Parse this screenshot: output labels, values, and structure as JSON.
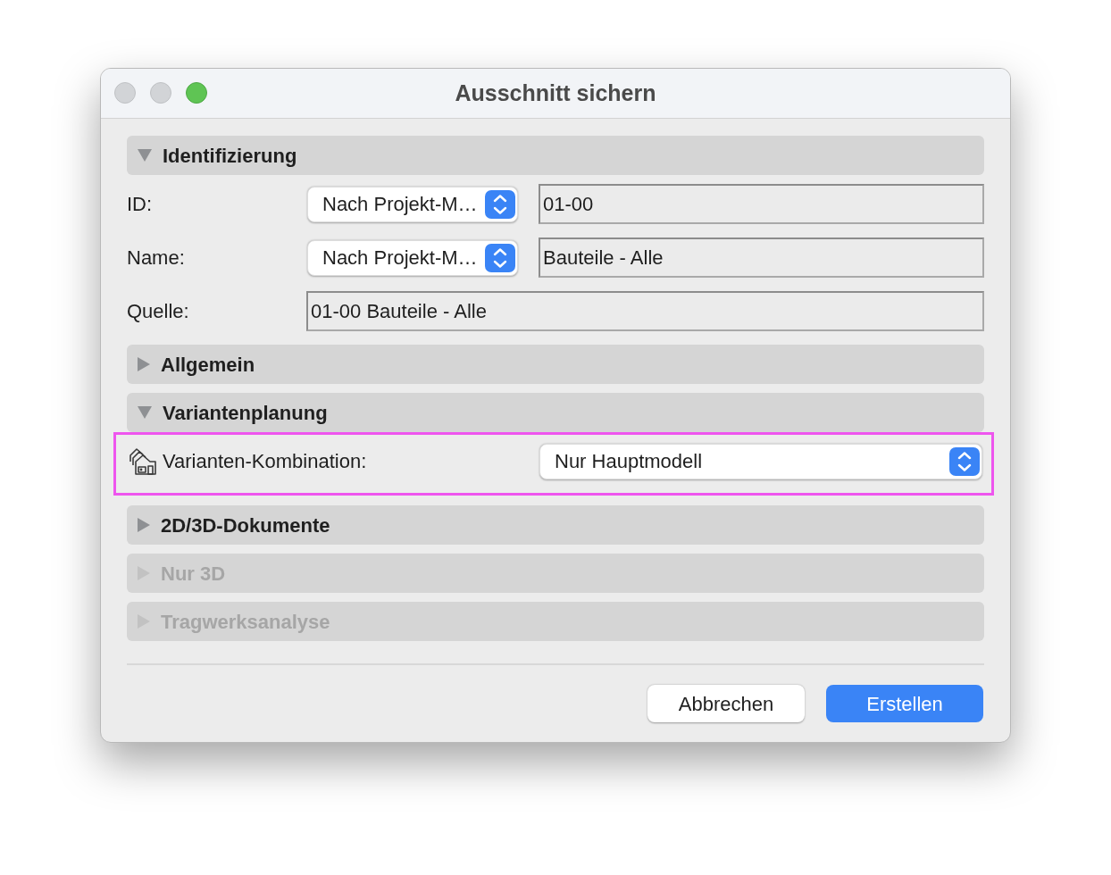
{
  "window": {
    "title": "Ausschnitt sichern",
    "traffic_lights": [
      {
        "kind": "close",
        "enabled": false
      },
      {
        "kind": "minimize",
        "enabled": false
      },
      {
        "kind": "zoom",
        "enabled": true
      }
    ]
  },
  "sections": [
    {
      "title": "Identifizierung",
      "expanded": true,
      "disabled": false,
      "rows": [
        {
          "kind": "popup_field",
          "label": "ID:",
          "popup": "Nach Projekt-M…",
          "value": "01-00",
          "highlighted": false
        },
        {
          "kind": "popup_field",
          "label": "Name:",
          "popup": "Nach Projekt-M…",
          "value": "Bauteile - Alle",
          "highlighted": false
        },
        {
          "kind": "field",
          "label": "Quelle:",
          "value": "01-00 Bauteile - Alle",
          "highlighted": false
        }
      ]
    },
    {
      "title": "Allgemein",
      "expanded": false,
      "disabled": false
    },
    {
      "title": "Variantenplanung",
      "expanded": true,
      "disabled": false,
      "rows": [
        {
          "kind": "icon_popup",
          "label": "Varianten-Kombination:",
          "popup": "Nur Hauptmodell",
          "highlighted": true
        }
      ]
    },
    {
      "title": "2D/3D-Dokumente",
      "expanded": false,
      "disabled": false
    },
    {
      "title": "Nur 3D",
      "expanded": false,
      "disabled": true
    },
    {
      "title": "Tragwerksanalyse",
      "expanded": false,
      "disabled": true
    }
  ],
  "buttons": [
    {
      "label": "Abbrechen",
      "default": false
    },
    {
      "label": "Erstellen",
      "default": true
    }
  ]
}
